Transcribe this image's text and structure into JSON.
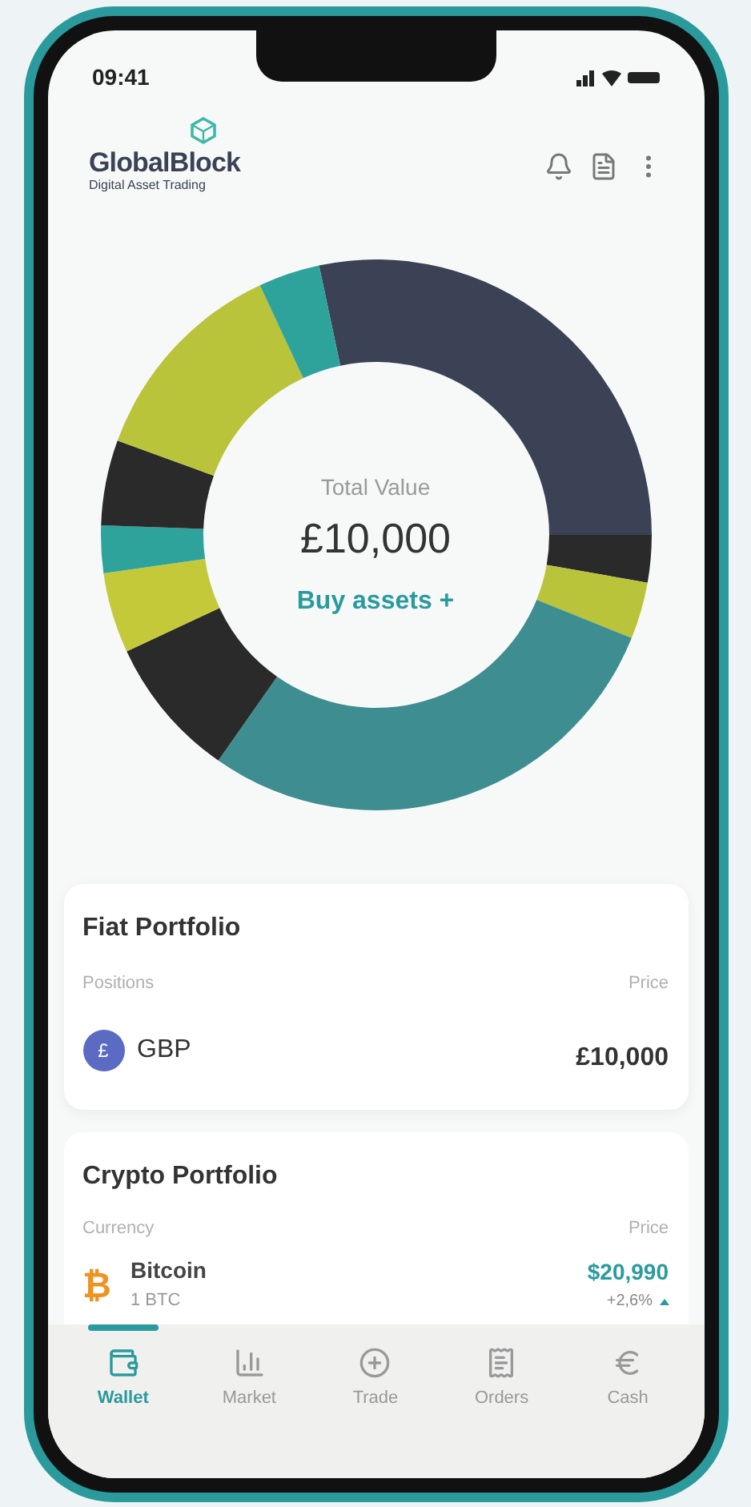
{
  "status_bar": {
    "time": "09:41"
  },
  "header": {
    "brand": "GlobalBlock",
    "tagline": "Digital Asset Trading"
  },
  "summary": {
    "label": "Total Value",
    "value": "£10,000",
    "action": "Buy assets +"
  },
  "fiat_portfolio": {
    "title": "Fiat Portfolio",
    "columns": [
      "Positions",
      "Price"
    ],
    "rows": [
      {
        "symbol": "£",
        "name": "GBP",
        "price": "£10,000"
      }
    ]
  },
  "crypto_portfolio": {
    "title": "Crypto Portfolio",
    "columns": [
      "Currency",
      "Price"
    ],
    "rows": [
      {
        "symbol": "₿",
        "name": "Bitcoin",
        "amount": "1 BTC",
        "price": "$20,990",
        "change": "+2,6%"
      }
    ]
  },
  "nav": [
    {
      "label": "Wallet",
      "kind": "wallet",
      "selected": true
    },
    {
      "label": "Market",
      "kind": "market",
      "selected": false
    },
    {
      "label": "Trade",
      "kind": "trade",
      "selected": false
    },
    {
      "label": "Orders",
      "kind": "orders",
      "selected": false
    },
    {
      "label": "Cash",
      "kind": "cash",
      "selected": false
    }
  ]
}
